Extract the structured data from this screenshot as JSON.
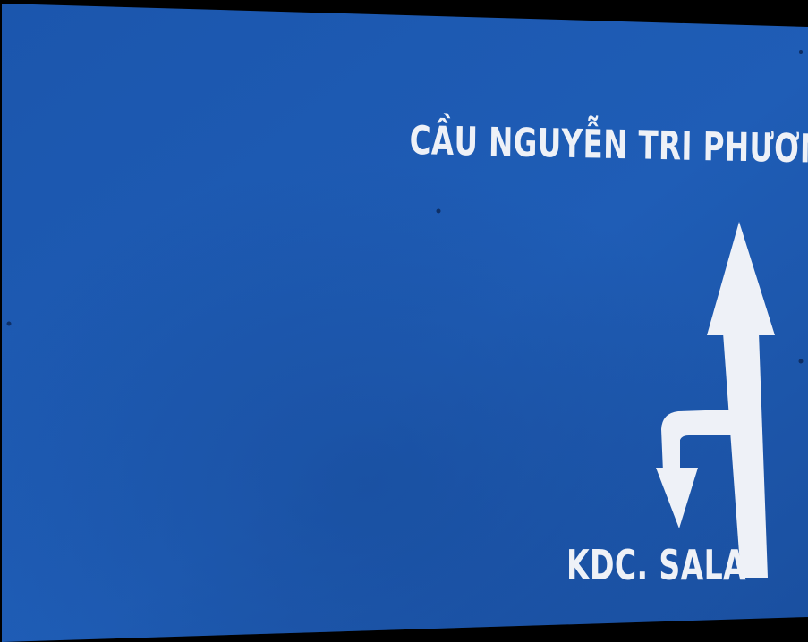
{
  "sign": {
    "background_color": "#1f5cb3",
    "text_color": "#eef1f7",
    "top_label": "CẦU NGUYỄN TRI PHƯƠNG",
    "bottom_label": "KDC. SALA",
    "arrow": "straight-ahead-with-u-turn-arrow"
  }
}
